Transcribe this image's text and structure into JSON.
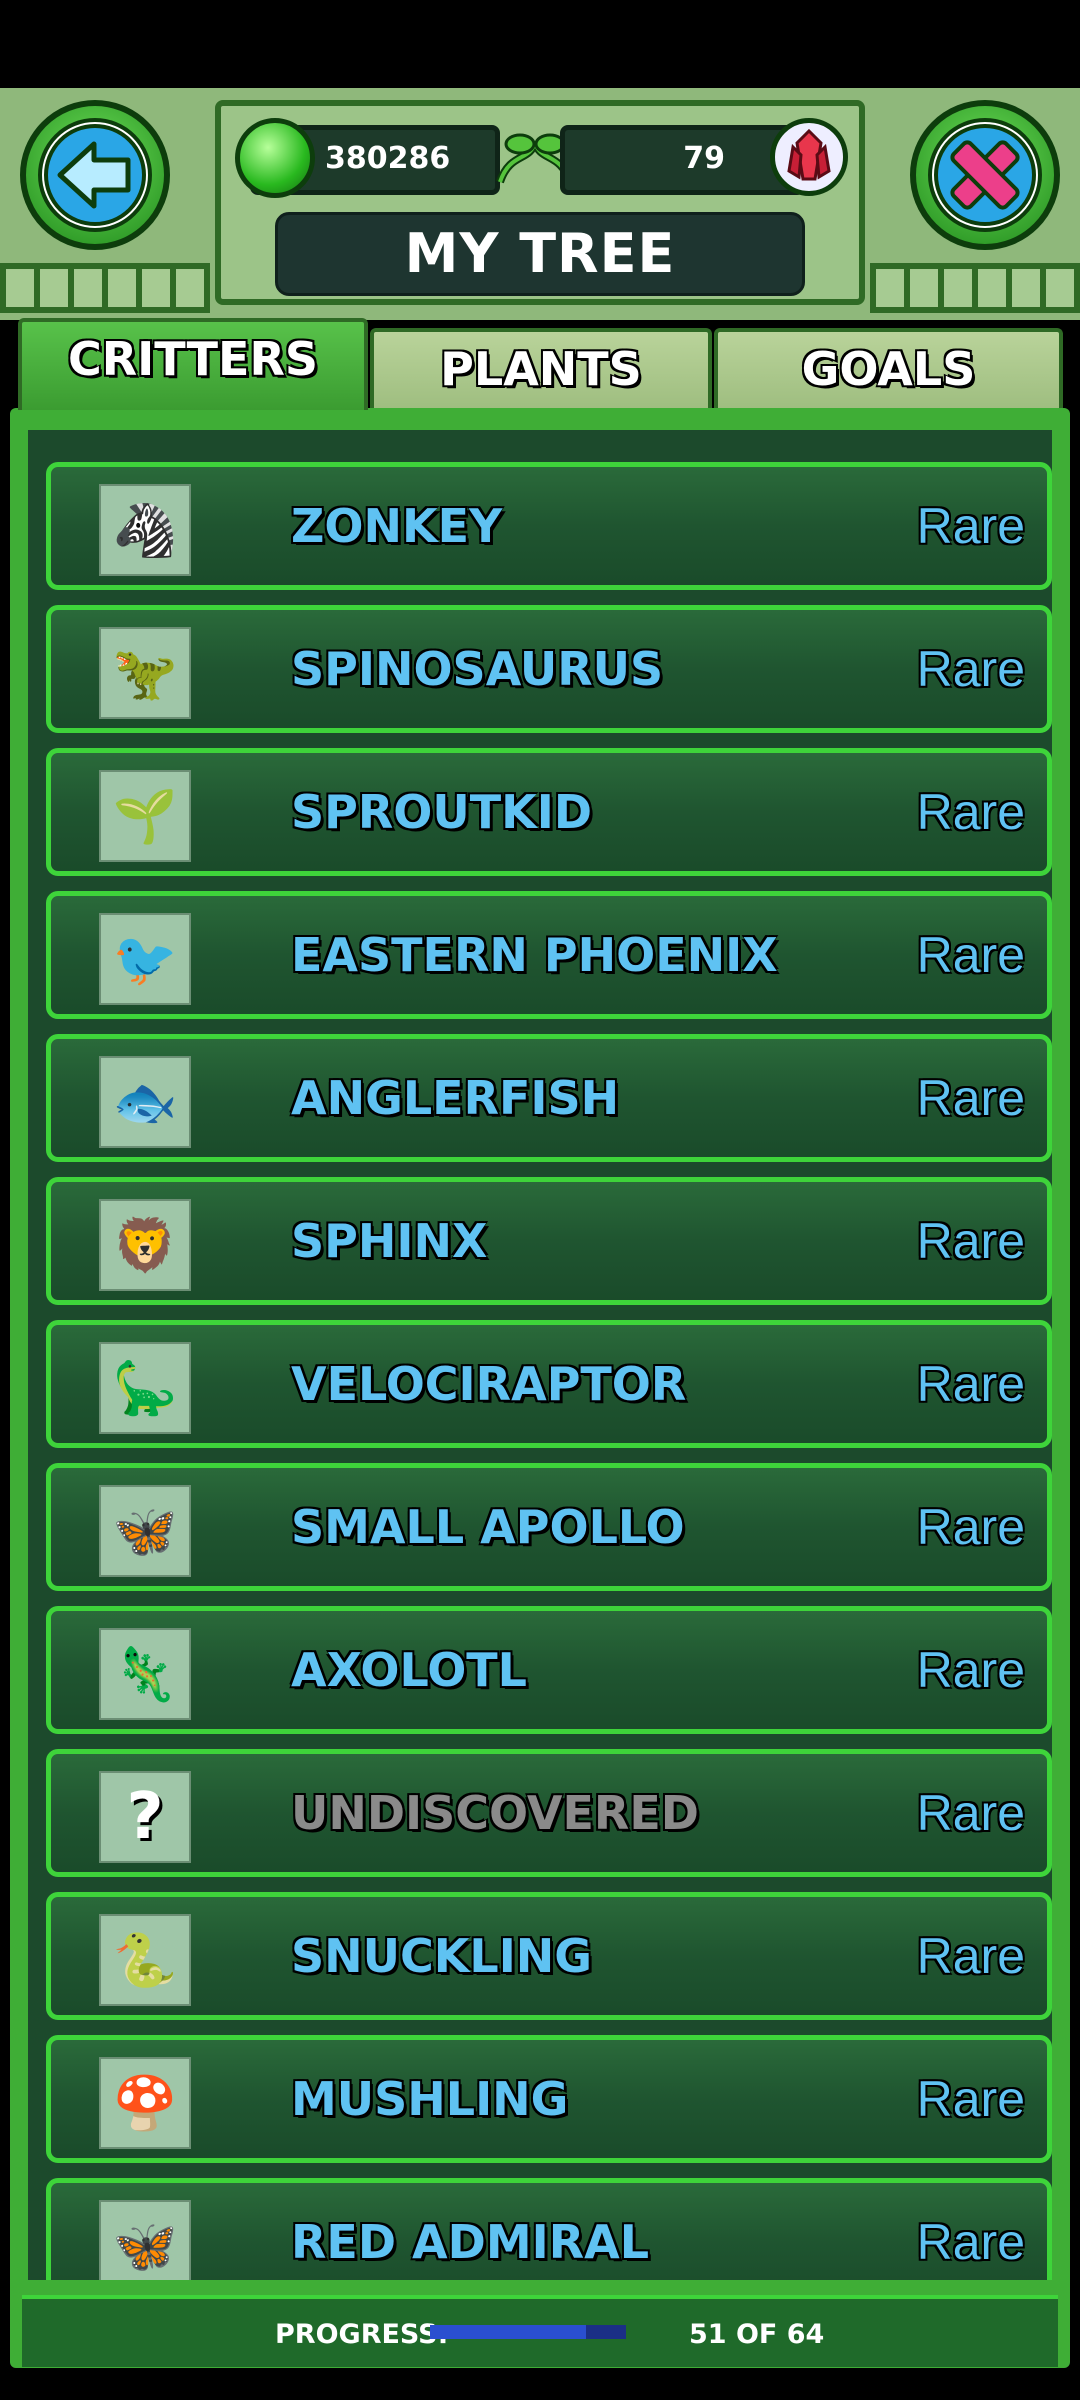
{
  "header": {
    "title": "MY TREE",
    "gems": "380286",
    "crystals": "79"
  },
  "tabs": [
    {
      "label": "CRITTERS",
      "active": true
    },
    {
      "label": "PLANTS",
      "active": false
    },
    {
      "label": "GOALS",
      "active": false
    }
  ],
  "critters": [
    {
      "name": "ZONKEY",
      "rarity": "Rare",
      "icon": "zonkey-icon"
    },
    {
      "name": "SPINOSAURUS",
      "rarity": "Rare",
      "icon": "spinosaurus-icon"
    },
    {
      "name": "SPROUTKID",
      "rarity": "Rare",
      "icon": "sproutkid-icon"
    },
    {
      "name": "EASTERN PHOENIX",
      "rarity": "Rare",
      "icon": "phoenix-icon"
    },
    {
      "name": "ANGLERFISH",
      "rarity": "Rare",
      "icon": "anglerfish-icon"
    },
    {
      "name": "SPHINX",
      "rarity": "Rare",
      "icon": "sphinx-icon"
    },
    {
      "name": "VELOCIRAPTOR",
      "rarity": "Rare",
      "icon": "velociraptor-icon"
    },
    {
      "name": "SMALL APOLLO",
      "rarity": "Rare",
      "icon": "butterfly-icon"
    },
    {
      "name": "AXOLOTL",
      "rarity": "Rare",
      "icon": "axolotl-icon"
    },
    {
      "name": "UNDISCOVERED",
      "rarity": "Rare",
      "icon": "question-mark-icon"
    },
    {
      "name": "SNUCKLING",
      "rarity": "Rare",
      "icon": "snuckling-icon"
    },
    {
      "name": "MUSHLING",
      "rarity": "Rare",
      "icon": "mushroom-icon"
    },
    {
      "name": "RED ADMIRAL",
      "rarity": "Rare",
      "icon": "red-admiral-icon"
    }
  ],
  "progress": {
    "label": "PROGRESS:",
    "count_text": "51 OF 64",
    "fraction": 0.797
  }
}
